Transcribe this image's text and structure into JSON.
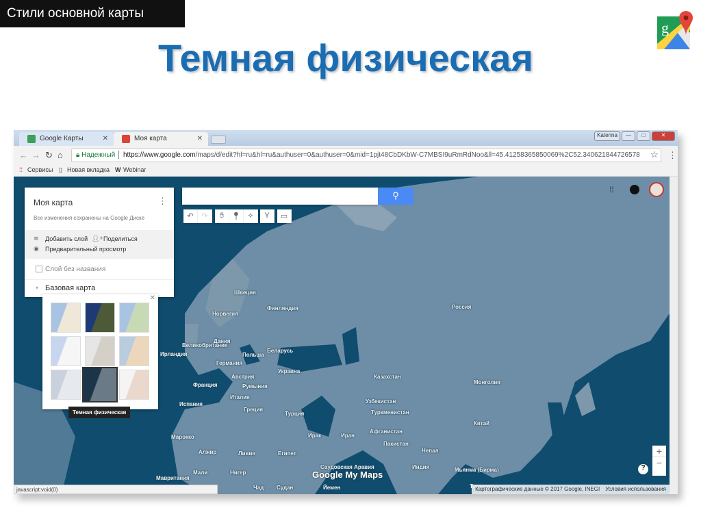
{
  "slide": {
    "tag": "Стили основной карты",
    "title": "Темная физическая"
  },
  "browser": {
    "tabs": [
      {
        "label": "Google Карты",
        "close": "✕"
      },
      {
        "label": "Моя карта",
        "close": "✕"
      }
    ],
    "user": "Katerina",
    "window_buttons": [
      "—",
      "□",
      "✕"
    ],
    "secure_label": "Надежный",
    "url_host": "https://www.google.com",
    "url_path": "/maps/d/edit?hl=ru&hl=ru&authuser=0&authuser=0&mid=1pjt48CbDKbW-C7MBSI9uRmRdNoo&ll=45.41258365850069%2C52.340621844726578",
    "bookmarks": [
      "Сервисы",
      "Новая вкладка",
      "Webinar"
    ],
    "status": "javascript:void(0)"
  },
  "panel": {
    "title": "Моя карта",
    "saved": "Все изменения сохранены на Google Диске",
    "add_layer": "Добавить слой",
    "share": "Поделиться",
    "preview": "Предварительный просмотр",
    "layer": "Слой без названия",
    "base_map": "Базовая карта"
  },
  "basemap_tooltip": "Темная физическая",
  "map": {
    "attribution": "Картографические данные © 2017 Google, INEGI",
    "terms": "Условия использования",
    "logo": "Google My Maps",
    "colors": {
      "ocean": "#0f4c6e",
      "land": "#6f8fa6",
      "accent": "#4a8af4"
    },
    "labels": [
      "Швеция",
      "Норвегия",
      "Финляндия",
      "Россия",
      "Великобритания",
      "Ирландия",
      "Дания",
      "Польша",
      "Беларусь",
      "Германия",
      "Украина",
      "Австрия",
      "Франция",
      "Румыния",
      "Италия",
      "Испания",
      "Греция",
      "Турция",
      "Казахстан",
      "Монголия",
      "Узбекистан",
      "Туркменистан",
      "Афганистан",
      "Иран",
      "Ирак",
      "Китай",
      "Пакистан",
      "Непал",
      "Индия",
      "Мьянма (Бирма)",
      "Таиланд",
      "Египет",
      "Ливия",
      "Алжир",
      "Марокко",
      "Мавритания",
      "Мали",
      "Нигер",
      "Чад",
      "Судан",
      "Саудовская Аравия",
      "Йемен"
    ]
  }
}
